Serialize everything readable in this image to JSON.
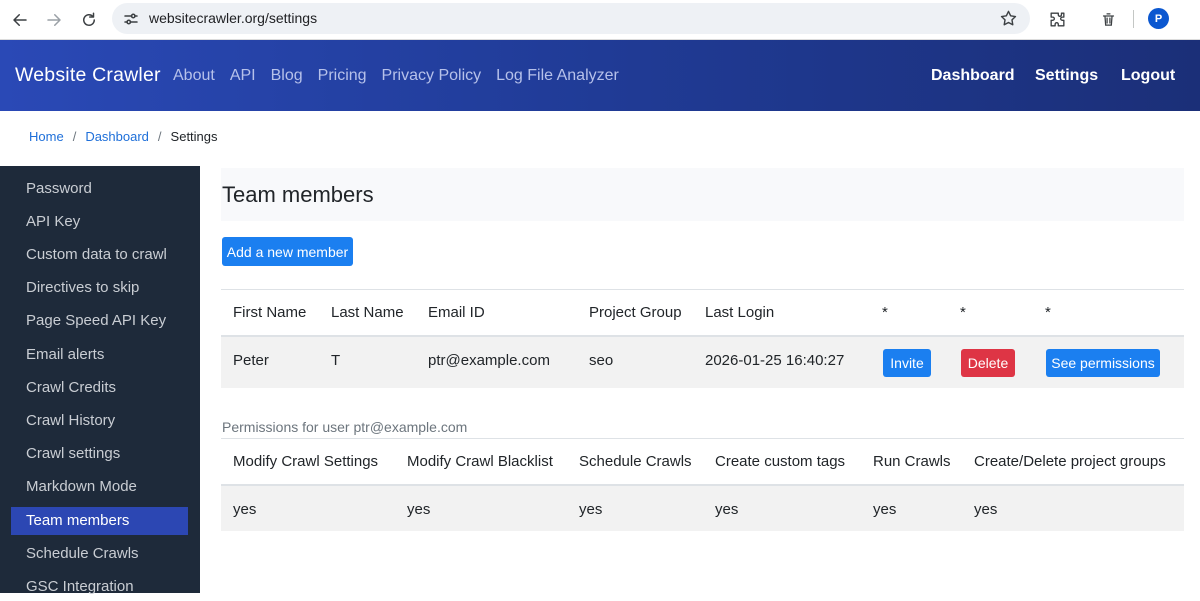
{
  "browser": {
    "url": "websitecrawler.org/settings",
    "profile_initial": "P"
  },
  "navbar": {
    "brand": "Website Crawler",
    "links": [
      "About",
      "API",
      "Blog",
      "Pricing",
      "Privacy Policy",
      "Log File Analyzer"
    ],
    "right": [
      "Dashboard",
      "Settings",
      "Logout"
    ]
  },
  "breadcrumb": {
    "home": "Home",
    "dashboard": "Dashboard",
    "current": "Settings",
    "separator": "/"
  },
  "sidebar": {
    "items": [
      "Password",
      "API Key",
      "Custom data to crawl",
      "Directives to skip",
      "Page Speed API Key",
      "Email alerts",
      "Crawl Credits",
      "Crawl History",
      "Crawl settings",
      "Markdown Mode",
      "Team members",
      "Schedule Crawls",
      "GSC Integration"
    ],
    "active_index": 10
  },
  "main": {
    "title": "Team members",
    "add_button": "Add a new member",
    "members_table": {
      "headers": [
        "First Name",
        "Last Name",
        "Email ID",
        "Project Group",
        "Last Login",
        "*",
        "*",
        "*"
      ],
      "rows": [
        {
          "first_name": "Peter",
          "last_name": "T",
          "email": "ptr@example.com",
          "project_group": "seo",
          "last_login": "2026-01-25 16:40:27",
          "invite_label": "Invite",
          "delete_label": "Delete",
          "permissions_label": "See permissions"
        }
      ]
    },
    "permissions": {
      "caption": "Permissions for user ptr@example.com",
      "headers": [
        "Modify Crawl Settings",
        "Modify Crawl Blacklist",
        "Schedule Crawls",
        "Create custom tags",
        "Run Crawls",
        "Create/Delete project groups"
      ],
      "values": [
        "yes",
        "yes",
        "yes",
        "yes",
        "yes",
        "yes"
      ]
    }
  },
  "colors": {
    "primary": "#1b7ff0",
    "danger": "#de3545",
    "sidebar_bg": "#1e2a3a",
    "sidebar_active": "#2c47b3",
    "navbar": "#2a49b6"
  }
}
